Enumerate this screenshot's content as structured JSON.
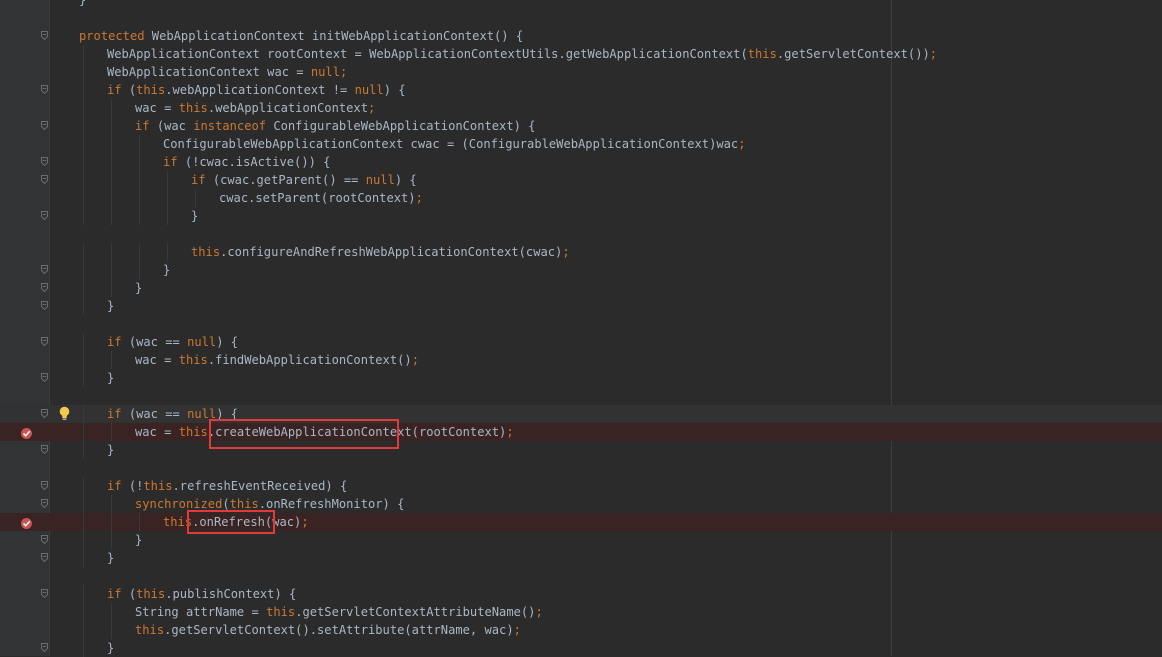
{
  "editor": {
    "lines": [
      {
        "indent": 0,
        "segs": [
          {
            "t": "}",
            "k": "p"
          }
        ]
      },
      {
        "indent": 0,
        "segs": []
      },
      {
        "indent": 0,
        "segs": [
          {
            "t": "protected",
            "k": "kw"
          },
          {
            "t": " WebApplicationContext initWebApplicationContext() {",
            "k": "p"
          }
        ]
      },
      {
        "indent": 1,
        "segs": [
          {
            "t": "WebApplicationContext rootContext = WebApplicationContextUtils.getWebApplicationContext(",
            "k": "p"
          },
          {
            "t": "this",
            "k": "kw"
          },
          {
            "t": ".getServletContext())",
            "k": "p"
          },
          {
            "t": ";",
            "k": "kw"
          }
        ]
      },
      {
        "indent": 1,
        "segs": [
          {
            "t": "WebApplicationContext wac = ",
            "k": "p"
          },
          {
            "t": "null",
            "k": "kw"
          },
          {
            "t": ";",
            "k": "kw"
          }
        ]
      },
      {
        "indent": 1,
        "segs": [
          {
            "t": "if",
            "k": "kw"
          },
          {
            "t": " (",
            "k": "p"
          },
          {
            "t": "this",
            "k": "kw"
          },
          {
            "t": ".webApplicationContext != ",
            "k": "p"
          },
          {
            "t": "null",
            "k": "kw"
          },
          {
            "t": ") {",
            "k": "p"
          }
        ]
      },
      {
        "indent": 2,
        "segs": [
          {
            "t": "wac = ",
            "k": "p"
          },
          {
            "t": "this",
            "k": "kw"
          },
          {
            "t": ".webApplicationContext",
            "k": "p"
          },
          {
            "t": ";",
            "k": "kw"
          }
        ]
      },
      {
        "indent": 2,
        "segs": [
          {
            "t": "if",
            "k": "kw"
          },
          {
            "t": " (wac ",
            "k": "p"
          },
          {
            "t": "instanceof",
            "k": "kw"
          },
          {
            "t": " ConfigurableWebApplicationContext) {",
            "k": "p"
          }
        ]
      },
      {
        "indent": 3,
        "segs": [
          {
            "t": "ConfigurableWebApplicationContext cwac = (ConfigurableWebApplicationContext)wac",
            "k": "p"
          },
          {
            "t": ";",
            "k": "kw"
          }
        ]
      },
      {
        "indent": 3,
        "segs": [
          {
            "t": "if",
            "k": "kw"
          },
          {
            "t": " (!cwac.isActive()) {",
            "k": "p"
          }
        ]
      },
      {
        "indent": 4,
        "segs": [
          {
            "t": "if",
            "k": "kw"
          },
          {
            "t": " (cwac.getParent() == ",
            "k": "p"
          },
          {
            "t": "null",
            "k": "kw"
          },
          {
            "t": ") {",
            "k": "p"
          }
        ]
      },
      {
        "indent": 5,
        "segs": [
          {
            "t": "cwac.setParent(rootContext)",
            "k": "p"
          },
          {
            "t": ";",
            "k": "kw"
          }
        ]
      },
      {
        "indent": 4,
        "segs": [
          {
            "t": "}",
            "k": "p"
          }
        ]
      },
      {
        "indent": 0,
        "segs": []
      },
      {
        "indent": 4,
        "segs": [
          {
            "t": "this",
            "k": "kw"
          },
          {
            "t": ".configureAndRefreshWebApplicationContext(cwac)",
            "k": "p"
          },
          {
            "t": ";",
            "k": "kw"
          }
        ]
      },
      {
        "indent": 3,
        "segs": [
          {
            "t": "}",
            "k": "p"
          }
        ]
      },
      {
        "indent": 2,
        "segs": [
          {
            "t": "}",
            "k": "p"
          }
        ]
      },
      {
        "indent": 1,
        "segs": [
          {
            "t": "}",
            "k": "p"
          }
        ]
      },
      {
        "indent": 0,
        "segs": []
      },
      {
        "indent": 1,
        "segs": [
          {
            "t": "if",
            "k": "kw"
          },
          {
            "t": " (wac == ",
            "k": "p"
          },
          {
            "t": "null",
            "k": "kw"
          },
          {
            "t": ") {",
            "k": "p"
          }
        ]
      },
      {
        "indent": 2,
        "segs": [
          {
            "t": "wac = ",
            "k": "p"
          },
          {
            "t": "this",
            "k": "kw"
          },
          {
            "t": ".findWebApplicationContext()",
            "k": "p"
          },
          {
            "t": ";",
            "k": "kw"
          }
        ]
      },
      {
        "indent": 1,
        "segs": [
          {
            "t": "}",
            "k": "p"
          }
        ]
      },
      {
        "indent": 0,
        "segs": []
      },
      {
        "indent": 1,
        "segs": [
          {
            "t": "if",
            "k": "kw"
          },
          {
            "t": " (wac == ",
            "k": "p"
          },
          {
            "t": "null",
            "k": "kw"
          },
          {
            "t": ") {",
            "k": "p"
          }
        ],
        "current": true,
        "bulb": true
      },
      {
        "indent": 2,
        "segs": [
          {
            "t": "wac = ",
            "k": "p"
          },
          {
            "t": "this",
            "k": "kw"
          },
          {
            "t": ".createWebApplicationContext(rootContext)",
            "k": "p"
          },
          {
            "t": ";",
            "k": "kw"
          }
        ],
        "breakpoint": true
      },
      {
        "indent": 1,
        "segs": [
          {
            "t": "}",
            "k": "p"
          }
        ]
      },
      {
        "indent": 0,
        "segs": []
      },
      {
        "indent": 1,
        "segs": [
          {
            "t": "if",
            "k": "kw"
          },
          {
            "t": " (!",
            "k": "p"
          },
          {
            "t": "this",
            "k": "kw"
          },
          {
            "t": ".refreshEventReceived) {",
            "k": "p"
          }
        ]
      },
      {
        "indent": 2,
        "segs": [
          {
            "t": "synchronized",
            "k": "kw"
          },
          {
            "t": "(",
            "k": "p"
          },
          {
            "t": "this",
            "k": "kw"
          },
          {
            "t": ".onRefreshMonitor) {",
            "k": "p"
          }
        ]
      },
      {
        "indent": 3,
        "segs": [
          {
            "t": "this",
            "k": "kw"
          },
          {
            "t": ".onRefresh(wac)",
            "k": "p"
          },
          {
            "t": ";",
            "k": "kw"
          }
        ],
        "breakpoint": true
      },
      {
        "indent": 2,
        "segs": [
          {
            "t": "}",
            "k": "p"
          }
        ]
      },
      {
        "indent": 1,
        "segs": [
          {
            "t": "}",
            "k": "p"
          }
        ]
      },
      {
        "indent": 0,
        "segs": []
      },
      {
        "indent": 1,
        "segs": [
          {
            "t": "if",
            "k": "kw"
          },
          {
            "t": " (",
            "k": "p"
          },
          {
            "t": "this",
            "k": "kw"
          },
          {
            "t": ".publishContext) {",
            "k": "p"
          }
        ]
      },
      {
        "indent": 2,
        "segs": [
          {
            "t": "String attrName = ",
            "k": "p"
          },
          {
            "t": "this",
            "k": "kw"
          },
          {
            "t": ".getServletContextAttributeName()",
            "k": "p"
          },
          {
            "t": ";",
            "k": "kw"
          }
        ]
      },
      {
        "indent": 2,
        "segs": [
          {
            "t": "this",
            "k": "kw"
          },
          {
            "t": ".getServletContext().setAttribute(attrName, wac)",
            "k": "p"
          },
          {
            "t": ";",
            "k": "kw"
          }
        ]
      },
      {
        "indent": 1,
        "segs": [
          {
            "t": "}",
            "k": "p"
          }
        ]
      }
    ]
  },
  "annotations": {
    "boxes": [
      "createWebApplicationContext",
      "onRefresh"
    ]
  },
  "colors": {
    "background": "#2b2b2b",
    "keyword": "#cc7832",
    "text": "#a9b7c6",
    "breakpoint_line": "#3a2323",
    "annotation_box": "#e03a3a"
  }
}
